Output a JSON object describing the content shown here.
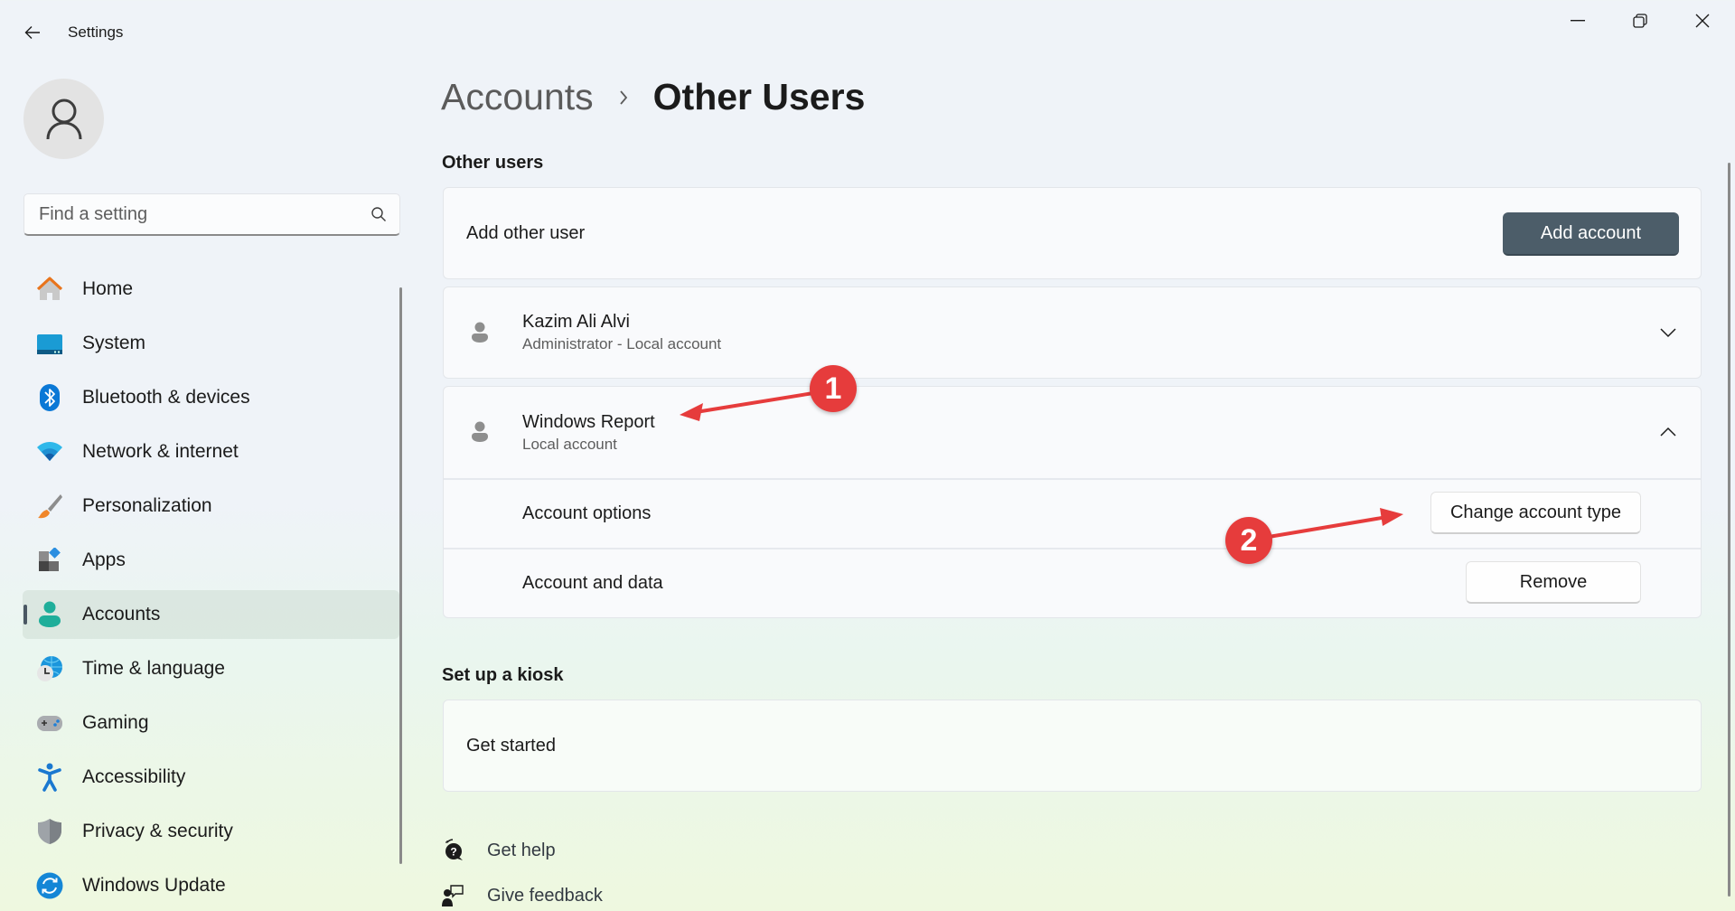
{
  "window": {
    "title": "Settings",
    "controls": {
      "minimize": "minimize",
      "maximize": "restore",
      "close": "close"
    }
  },
  "sidebar": {
    "search_placeholder": "Find a setting",
    "items": [
      {
        "label": "Home",
        "icon": "home-icon",
        "active": false
      },
      {
        "label": "System",
        "icon": "system-icon",
        "active": false
      },
      {
        "label": "Bluetooth & devices",
        "icon": "bluetooth-icon",
        "active": false
      },
      {
        "label": "Network & internet",
        "icon": "wifi-icon",
        "active": false
      },
      {
        "label": "Personalization",
        "icon": "paintbrush-icon",
        "active": false
      },
      {
        "label": "Apps",
        "icon": "apps-icon",
        "active": false
      },
      {
        "label": "Accounts",
        "icon": "accounts-icon",
        "active": true
      },
      {
        "label": "Time & language",
        "icon": "globe-clock-icon",
        "active": false
      },
      {
        "label": "Gaming",
        "icon": "gamepad-icon",
        "active": false
      },
      {
        "label": "Accessibility",
        "icon": "accessibility-icon",
        "active": false
      },
      {
        "label": "Privacy & security",
        "icon": "shield-icon",
        "active": false
      },
      {
        "label": "Windows Update",
        "icon": "update-icon",
        "active": false
      }
    ]
  },
  "breadcrumb": {
    "parent": "Accounts",
    "current": "Other Users"
  },
  "other_users": {
    "section_title": "Other users",
    "add_user_label": "Add other user",
    "add_account_button": "Add account",
    "users": [
      {
        "name": "Kazim Ali Alvi",
        "subtitle": "Administrator - Local account",
        "expanded": false
      },
      {
        "name": "Windows Report",
        "subtitle": "Local account",
        "expanded": true,
        "options": [
          {
            "label": "Account options",
            "button": "Change account type"
          },
          {
            "label": "Account and data",
            "button": "Remove"
          }
        ]
      }
    ]
  },
  "kiosk": {
    "section_title": "Set up a kiosk",
    "row_label": "Get started"
  },
  "footer_links": [
    {
      "label": "Get help",
      "icon": "help-icon"
    },
    {
      "label": "Give feedback",
      "icon": "feedback-icon"
    }
  ],
  "annotations": [
    {
      "number": "1",
      "color": "#e63c3c",
      "points_to": "Windows Report"
    },
    {
      "number": "2",
      "color": "#e63c3c",
      "points_to": "Change account type"
    }
  ],
  "colors": {
    "primary_button": "#4c5d69",
    "active_indicator": "#4a5763",
    "annotation_red": "#e63c3c"
  }
}
